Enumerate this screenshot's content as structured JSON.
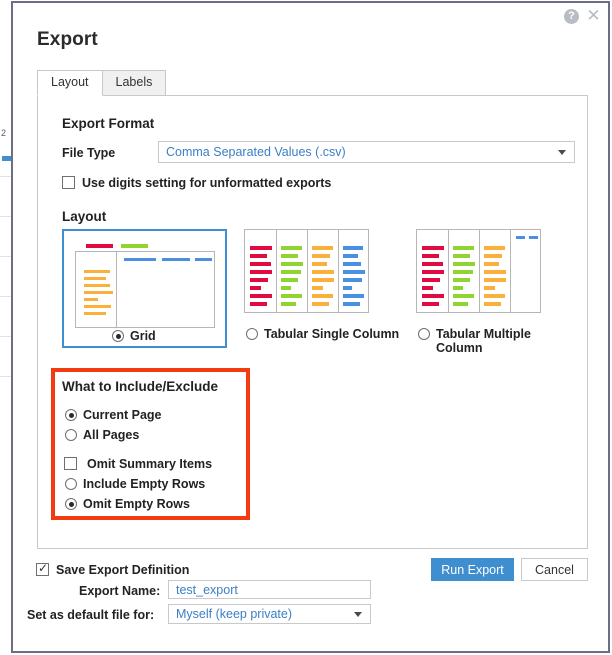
{
  "window": {
    "title": "Export",
    "help_icon": "help-question-icon",
    "close_icon": "close-x-icon"
  },
  "tabs": [
    {
      "label": "Layout",
      "active": true
    },
    {
      "label": "Labels",
      "active": false
    }
  ],
  "export_format": {
    "section_title": "Export Format",
    "file_type_label": "File Type",
    "file_type_value": "Comma Separated Values (.csv)",
    "digits_checkbox_label": "Use digits setting for unformatted exports",
    "digits_checkbox_checked": false
  },
  "layout": {
    "section_title": "Layout",
    "options": [
      {
        "label": "Grid",
        "selected": true
      },
      {
        "label": "Tabular Single Column",
        "selected": false
      },
      {
        "label": "Tabular Multiple Column",
        "selected": false
      }
    ]
  },
  "include_exclude": {
    "section_title": "What to Include/Exclude",
    "page_scope": [
      {
        "label": "Current Page",
        "selected": true
      },
      {
        "label": "All Pages",
        "selected": false
      }
    ],
    "omit_summary": {
      "label": "Omit Summary Items",
      "checked": false
    },
    "empty_rows": [
      {
        "label": "Include Empty Rows",
        "selected": false
      },
      {
        "label": "Omit Empty Rows",
        "selected": true
      }
    ],
    "highlight_color": "#f23b11"
  },
  "footer": {
    "save_definition_label": "Save Export Definition",
    "save_definition_checked": true,
    "export_name_label": "Export Name:",
    "export_name_value": "test_export",
    "default_file_label": "Set as default file for:",
    "default_file_value": "Myself (keep private)",
    "run_export_label": "Run Export",
    "cancel_label": "Cancel",
    "primary_color": "#3f8ed0"
  },
  "colors": {
    "thumb_red": "#e00b41",
    "thumb_green": "#8fd430",
    "thumb_orange": "#fbb03b",
    "thumb_blue": "#4a90e2",
    "link_blue": "#3b7fc4"
  },
  "behind_page": {
    "text_snippets": [
      "2"
    ]
  }
}
